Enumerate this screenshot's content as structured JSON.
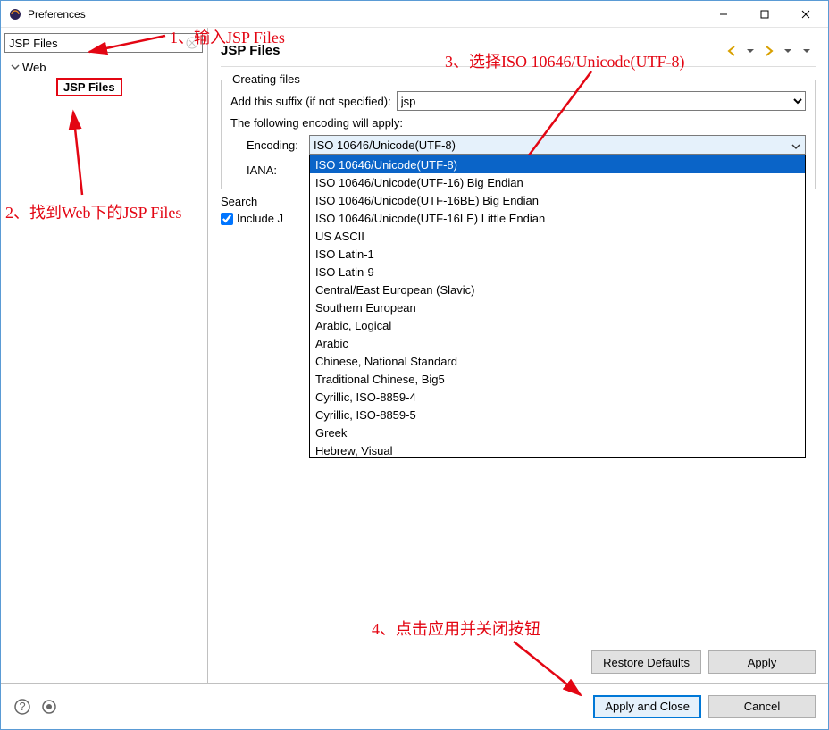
{
  "window": {
    "title": "Preferences"
  },
  "sidebar": {
    "search_value": "JSP Files",
    "tree": {
      "root": "Web",
      "child": "JSP Files"
    }
  },
  "main": {
    "title": "JSP Files",
    "group_title": "Creating files",
    "suffix_label": "Add this suffix (if not specified):",
    "suffix_value": "jsp",
    "encoding_line": "The following encoding will apply:",
    "encoding_label": "Encoding:",
    "encoding_value": "ISO 10646/Unicode(UTF-8)",
    "iana_label": "IANA:",
    "search_section_label": "Search",
    "include_checkbox_label": "Include JSP matches in Java searches",
    "include_checkbox_partial": "Include J",
    "buttons": {
      "restore": "Restore Defaults",
      "apply": "Apply",
      "apply_close": "Apply and Close",
      "cancel": "Cancel"
    }
  },
  "dropdown": {
    "items": [
      "ISO 10646/Unicode(UTF-8)",
      "ISO 10646/Unicode(UTF-16) Big Endian",
      "ISO 10646/Unicode(UTF-16BE) Big Endian",
      "ISO 10646/Unicode(UTF-16LE) Little Endian",
      "US ASCII",
      "ISO Latin-1",
      "ISO Latin-9",
      "Central/East European (Slavic)",
      "Southern European",
      "Arabic, Logical",
      "Arabic",
      "Chinese, National Standard",
      "Traditional Chinese, Big5",
      "Cyrillic, ISO-8859-4",
      "Cyrillic, ISO-8859-5",
      "Greek",
      "Hebrew, Visual"
    ]
  },
  "annotations": {
    "a1": "1、输入JSP Files",
    "a2": "2、找到Web下的JSP Files",
    "a3": "3、选择ISO 10646/Unicode(UTF-8)",
    "a4": "4、点击应用并关闭按钮"
  }
}
